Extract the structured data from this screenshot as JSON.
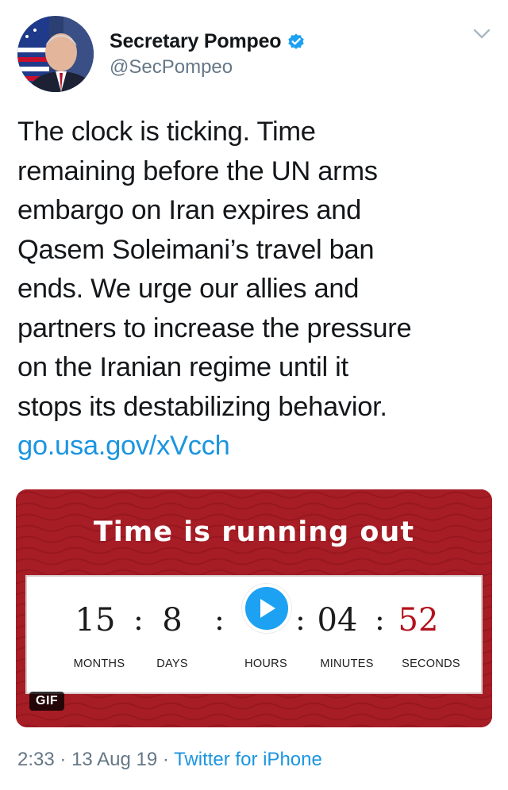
{
  "author": {
    "display_name": "Secretary Pompeo",
    "handle": "@SecPompeo",
    "verified": true,
    "avatar_icon": "portrait-with-flag"
  },
  "tweet": {
    "lines": [
      "The clock is ticking. Time",
      "remaining before the UN arms",
      "embargo on Iran expires and",
      "Qasem Soleimani’s travel ban",
      "ends. We urge our allies and",
      "partners to increase the pressure",
      "on the Iranian regime until it",
      "stops its destabilizing behavior."
    ],
    "link": "go.usa.gov/xVcch"
  },
  "media": {
    "title": "Time is running out",
    "separator": ":",
    "countdown": [
      {
        "value": "15",
        "unit": "MONTHS"
      },
      {
        "value": "8",
        "unit": "DAYS"
      },
      {
        "value": "",
        "unit": "HOURS"
      },
      {
        "value": "04",
        "unit": "MINUTES"
      },
      {
        "value": "52",
        "unit": "SECONDS"
      }
    ],
    "badge": "GIF",
    "colors": {
      "background": "#a71d25",
      "seconds": "#b3121c",
      "play": "#1da1f2"
    }
  },
  "meta": {
    "time": "2:33",
    "sep1": "·",
    "date": "13 Aug 19",
    "sep2": "·",
    "source": "Twitter for iPhone"
  }
}
